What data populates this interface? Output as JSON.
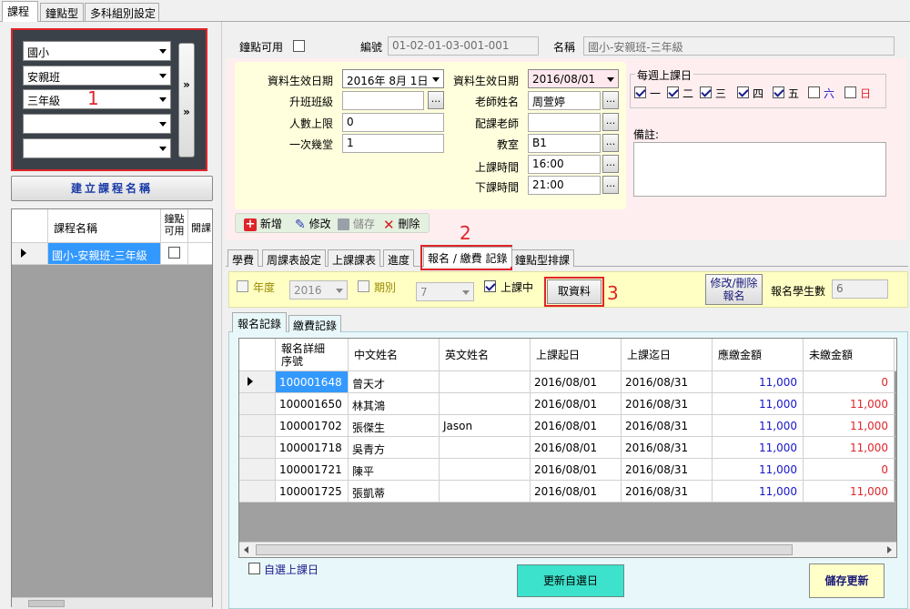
{
  "top_tabs": [
    "課程",
    "鐘點型",
    "多科組別設定"
  ],
  "filters": {
    "items": [
      "國小",
      "安親班",
      "三年級",
      "",
      ""
    ],
    "expand_label": "»",
    "annotation": "1"
  },
  "build_button": "建立課程名稱",
  "course_grid": {
    "headers": [
      "課程名稱",
      "鐘點可用",
      "開課"
    ],
    "rows": [
      {
        "name": "國小-安親班-三年級"
      }
    ]
  },
  "detail": {
    "hourly_label": "鐘點可用",
    "code_label": "編號",
    "code_value": "01-02-01-03-001-001",
    "name_label": "名稱",
    "name_value": "國小-安親班-三年級"
  },
  "form": {
    "eff_date_label": "資料生效日期",
    "eff_date_value": "2016年  8月  1日",
    "promote_label": "升班班級",
    "limit_label": "人數上限",
    "limit_value": "0",
    "periods_label": "一次幾堂",
    "periods_value": "1",
    "eff_date2_label": "資料生效日期",
    "eff_date2_value": "2016/08/01",
    "teacher_label": "老師姓名",
    "teacher_value": "周萱婷",
    "assist_label": "配課老師",
    "room_label": "教室",
    "room_value": "B1",
    "start_label": "上課時間",
    "start_value": "16:00",
    "end_label": "下課時間",
    "end_value": "21:00",
    "weekly_label": "每週上課日",
    "days": [
      {
        "label": "一",
        "checked": true,
        "color": "#000000"
      },
      {
        "label": "二",
        "checked": true,
        "color": "#000000"
      },
      {
        "label": "三",
        "checked": true,
        "color": "#000000"
      },
      {
        "label": "四",
        "checked": true,
        "color": "#000000"
      },
      {
        "label": "五",
        "checked": true,
        "color": "#000000"
      },
      {
        "label": "六",
        "checked": false,
        "color": "#1515c8"
      },
      {
        "label": "日",
        "checked": false,
        "color": "#e0242a"
      }
    ],
    "remark_label": "備註:",
    "dots": "..."
  },
  "toolbar": {
    "add": "新增",
    "edit": "修改",
    "save": "儲存",
    "delete": "刪除"
  },
  "mid_tabs": [
    "學費",
    "周課表設定",
    "上課課表",
    "進度",
    "報名 / 繳費 記錄",
    "鐘點型排課"
  ],
  "annotations": {
    "tab": "2",
    "fetch": "3"
  },
  "filter_bar": {
    "year_label": "年度",
    "year_value": "2016",
    "term_label": "期別",
    "term_value": "7",
    "active_label": "上課中",
    "fetch_button": "取資料",
    "modify_button": "修改/刪除報名",
    "count_label": "報名學生數",
    "count_value": "6"
  },
  "sub_tabs": [
    "報名記錄",
    "繳費記錄"
  ],
  "reg_grid": {
    "headers": [
      "報名詳細\n序號",
      "中文姓名",
      "英文姓名",
      "上課起日",
      "上課迄日",
      "應繳金額",
      "未繳金額"
    ],
    "rows": [
      {
        "id": "100001648",
        "cname": "曾天才",
        "ename": "",
        "start": "2016/08/01",
        "end": "2016/08/31",
        "due": "11,000",
        "unpaid": "0"
      },
      {
        "id": "100001650",
        "cname": "林其鴻",
        "ename": "",
        "start": "2016/08/01",
        "end": "2016/08/31",
        "due": "11,000",
        "unpaid": "11,000"
      },
      {
        "id": "100001702",
        "cname": "張傑生",
        "ename": "Jason",
        "start": "2016/08/01",
        "end": "2016/08/31",
        "due": "11,000",
        "unpaid": "11,000"
      },
      {
        "id": "100001718",
        "cname": "吳青方",
        "ename": "",
        "start": "2016/08/01",
        "end": "2016/08/31",
        "due": "11,000",
        "unpaid": "11,000"
      },
      {
        "id": "100001721",
        "cname": "陳平",
        "ename": "",
        "start": "2016/08/01",
        "end": "2016/08/31",
        "due": "11,000",
        "unpaid": "0"
      },
      {
        "id": "100001725",
        "cname": "張凱蒂",
        "ename": "",
        "start": "2016/08/01",
        "end": "2016/08/31",
        "due": "11,000",
        "unpaid": "11,000"
      }
    ],
    "overflow_glyph": "未"
  },
  "bottom": {
    "custom_day_label": "自選上課日",
    "update_button": "更新自選日",
    "save_button": "儲存更新"
  },
  "colors": {
    "accent": "#e0242a",
    "due": "#1515c8",
    "unpaid": "#e0242a",
    "form_bg": "#ffffdd",
    "pink_bg": "#ffeef0"
  }
}
